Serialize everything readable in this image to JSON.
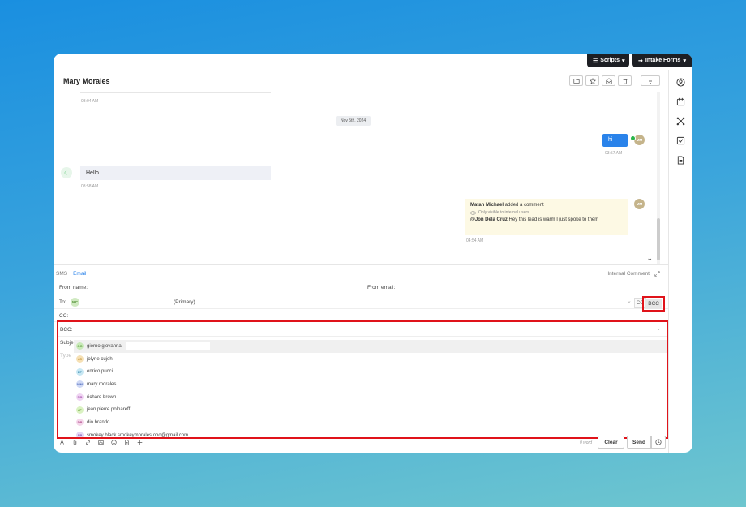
{
  "topbar": {
    "scripts_label": "Scripts",
    "intake_label": "Intake Forms"
  },
  "header": {
    "contact_name": "Mary Morales"
  },
  "chat": {
    "first_time": "03:04 AM",
    "date_divider": "Nov 5th, 2024",
    "outgoing": {
      "text": "hi",
      "time": "03:57 AM",
      "avatar": "MM"
    },
    "incoming": {
      "text": "Hello",
      "time": "03:58 AM"
    },
    "comment": {
      "author": "Matan Michael",
      "action": "added a comment",
      "visibility": "Only visible to internal users",
      "mention": "@Jon Dela Cruz",
      "body": "Hey this lead is warm I just spoke to them",
      "time": "04:54 AM",
      "avatar": "MM"
    }
  },
  "compose": {
    "tab_sms": "SMS",
    "tab_email": "Email",
    "internal_comment": "Internal Comment",
    "from_name_label": "From name:",
    "from_email_label": "From email:",
    "to_label": "To:",
    "to_chip": "MC",
    "to_primary": "(Primary)",
    "cc_button": "CC",
    "bcc_button": "BCC",
    "cc_label": "CC:",
    "bcc_label": "BCC:",
    "subject_label": "Subje",
    "type_placeholder": "Type",
    "word_count": "0 word",
    "clear_label": "Clear",
    "send_label": "Send"
  },
  "bcc_dropdown": [
    {
      "initials": "GG",
      "name": "giorno giovanna",
      "color": "#c8eab8",
      "text": "#5b9a3c"
    },
    {
      "initials": "JC",
      "name": "jolyne cujoh",
      "color": "#f6e0b4",
      "text": "#b98a2a"
    },
    {
      "initials": "EP",
      "name": "enrico pucci",
      "color": "#c7e7f3",
      "text": "#3a8cb0"
    },
    {
      "initials": "MM",
      "name": "mary morales",
      "color": "#cfd9f5",
      "text": "#4a66b8"
    },
    {
      "initials": "RB",
      "name": "richard brown",
      "color": "#efd4f2",
      "text": "#a651b0"
    },
    {
      "initials": "JP",
      "name": "jean pierre polnareff",
      "color": "#daf2c2",
      "text": "#5c9a2a"
    },
    {
      "initials": "DB",
      "name": "dio brando",
      "color": "#f4d6ea",
      "text": "#b04a8a"
    },
    {
      "initials": "SB",
      "name": "smokey black smokeymorales.ooo@gmail.com",
      "color": "#e3d6f4",
      "text": "#7a52b0"
    }
  ],
  "colors": {
    "accent": "#2a83ea",
    "highlight": "#e0131a",
    "dark": "#1d1f24"
  }
}
